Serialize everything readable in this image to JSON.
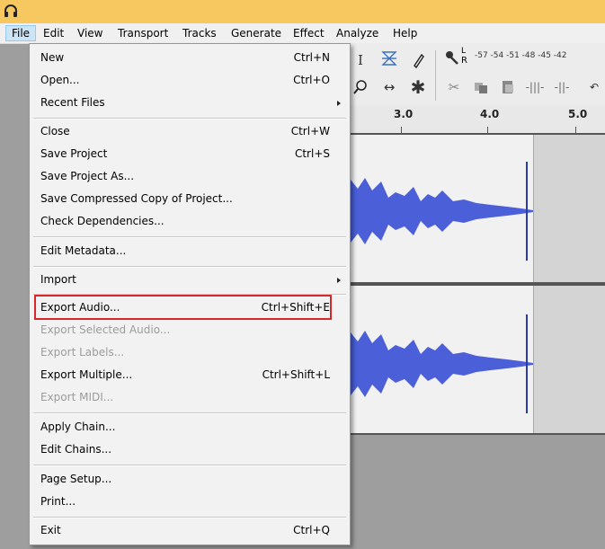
{
  "menubar": {
    "items": [
      {
        "label": "File"
      },
      {
        "label": "Edit"
      },
      {
        "label": "View"
      },
      {
        "label": "Transport"
      },
      {
        "label": "Tracks"
      },
      {
        "label": "Generate"
      },
      {
        "label": "Effect"
      },
      {
        "label": "Analyze"
      },
      {
        "label": "Help"
      }
    ]
  },
  "toolbar": {
    "meter_scale": "-57 -54 -51 -48 -45 -42",
    "meter_channel": "R",
    "meter_channel_top": "L"
  },
  "ruler": {
    "ticks": [
      "3.0",
      "4.0",
      "5.0"
    ]
  },
  "file_menu": {
    "items": [
      {
        "label": "New",
        "shortcut": "Ctrl+N"
      },
      {
        "label": "Open...",
        "shortcut": "Ctrl+O"
      },
      {
        "label": "Recent Files",
        "shortcut": ""
      },
      {
        "label": "Close",
        "shortcut": "Ctrl+W"
      },
      {
        "label": "Save Project",
        "shortcut": "Ctrl+S"
      },
      {
        "label": "Save Project As...",
        "shortcut": ""
      },
      {
        "label": "Save Compressed Copy of Project...",
        "shortcut": ""
      },
      {
        "label": "Check Dependencies...",
        "shortcut": ""
      },
      {
        "label": "Edit Metadata...",
        "shortcut": ""
      },
      {
        "label": "Import",
        "shortcut": ""
      },
      {
        "label": "Export Audio...",
        "shortcut": "Ctrl+Shift+E"
      },
      {
        "label": "Export Selected Audio...",
        "shortcut": ""
      },
      {
        "label": "Export Labels...",
        "shortcut": ""
      },
      {
        "label": "Export Multiple...",
        "shortcut": "Ctrl+Shift+L"
      },
      {
        "label": "Export MIDI...",
        "shortcut": ""
      },
      {
        "label": "Apply Chain...",
        "shortcut": ""
      },
      {
        "label": "Edit Chains...",
        "shortcut": ""
      },
      {
        "label": "Page Setup...",
        "shortcut": ""
      },
      {
        "label": "Print...",
        "shortcut": ""
      },
      {
        "label": "Exit",
        "shortcut": "Ctrl+Q"
      }
    ]
  },
  "colors": {
    "titlebar": "#f7c760",
    "waveform": "#4a5fd8",
    "highlight": "#d6282a"
  }
}
